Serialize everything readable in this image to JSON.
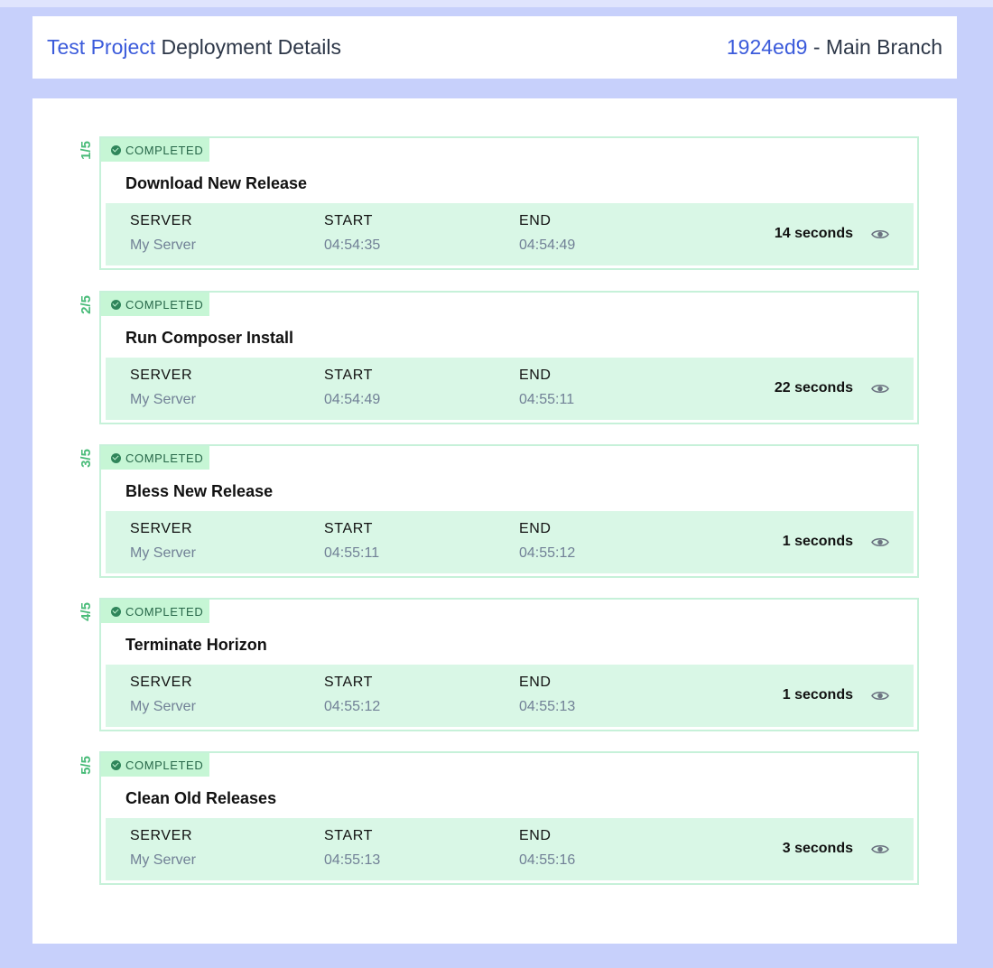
{
  "header": {
    "project_name": "Test Project",
    "title_rest": " Deployment Details",
    "commit_hash": "1924ed9",
    "branch_rest": " - Main Branch"
  },
  "column_labels": {
    "server": "SERVER",
    "start": "START",
    "end": "END"
  },
  "steps": [
    {
      "counter": "1/5",
      "status": "COMPLETED",
      "title": "Download New Release",
      "server": "My Server",
      "start": "04:54:35",
      "end": "04:54:49",
      "duration": "14 seconds"
    },
    {
      "counter": "2/5",
      "status": "COMPLETED",
      "title": "Run Composer Install",
      "server": "My Server",
      "start": "04:54:49",
      "end": "04:55:11",
      "duration": "22 seconds"
    },
    {
      "counter": "3/5",
      "status": "COMPLETED",
      "title": "Bless New Release",
      "server": "My Server",
      "start": "04:55:11",
      "end": "04:55:12",
      "duration": "1 seconds"
    },
    {
      "counter": "4/5",
      "status": "COMPLETED",
      "title": "Terminate Horizon",
      "server": "My Server",
      "start": "04:55:12",
      "end": "04:55:13",
      "duration": "1 seconds"
    },
    {
      "counter": "5/5",
      "status": "COMPLETED",
      "title": "Clean Old Releases",
      "server": "My Server",
      "start": "04:55:13",
      "end": "04:55:16",
      "duration": "3 seconds"
    }
  ],
  "icons": {
    "status": "check-circle-icon",
    "view": "eye-icon"
  },
  "colors": {
    "accent": "#3b5bdb",
    "success": "#48bb78",
    "success_light": "#d9f7e6",
    "page_bg": "#c7d0fb"
  }
}
